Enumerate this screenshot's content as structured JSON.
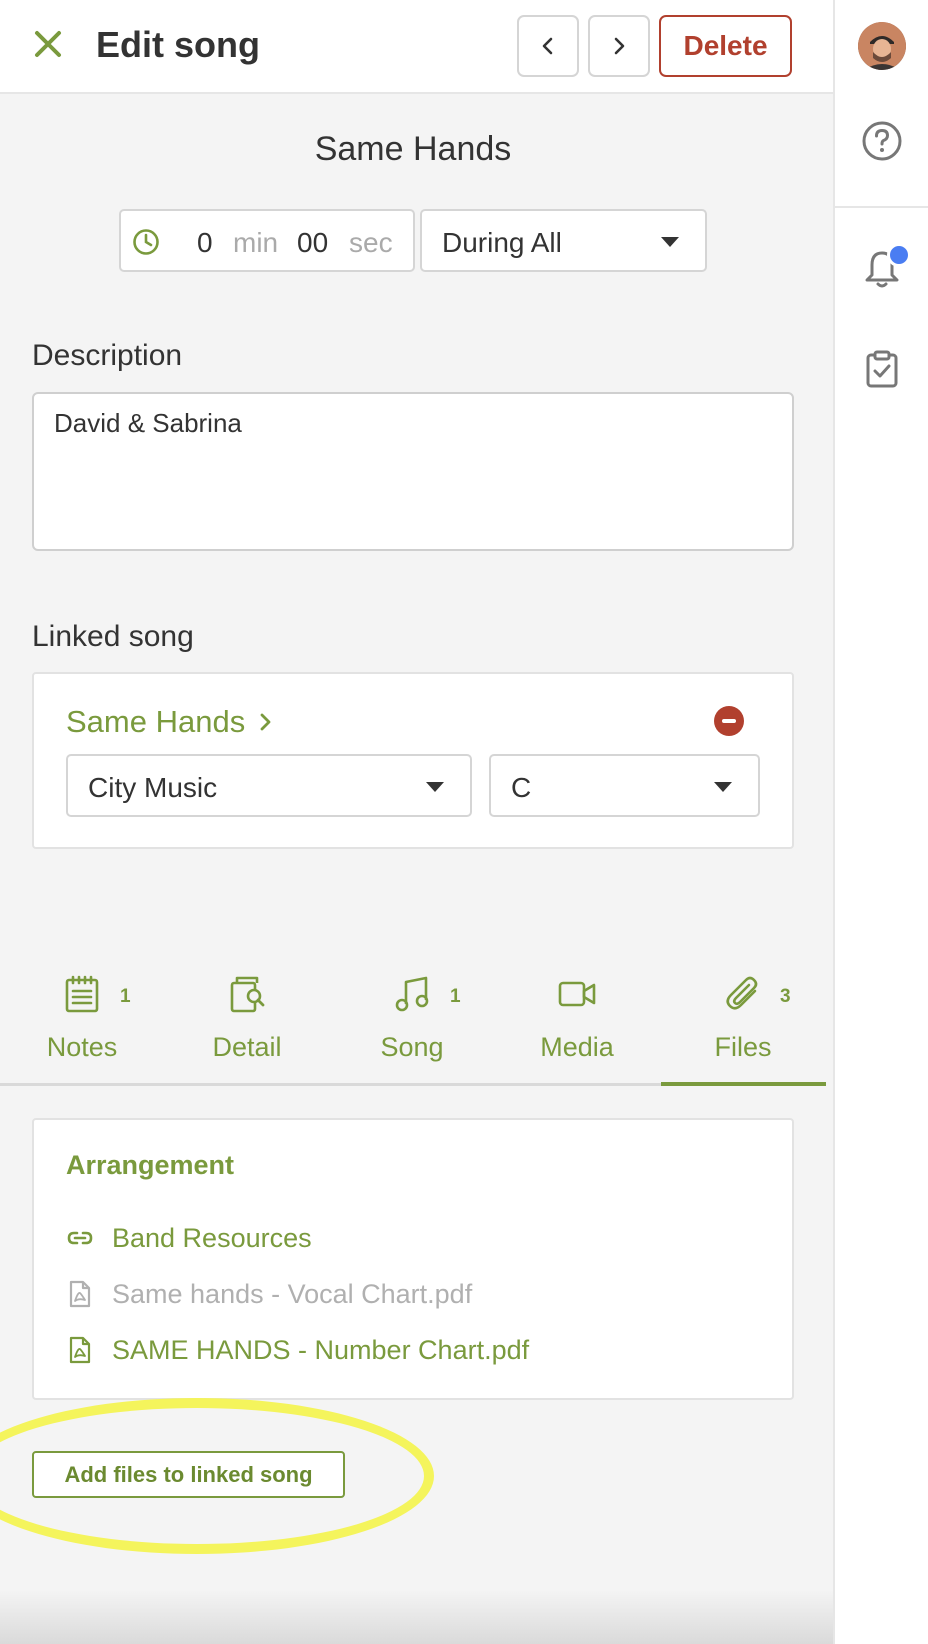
{
  "header": {
    "title": "Edit song",
    "delete_label": "Delete"
  },
  "colors": {
    "accent_green": "#7a9a3d",
    "danger_red": "#b1402e",
    "notification_blue": "#4a7df2",
    "highlight_yellow": "#f4f45c"
  },
  "song": {
    "title": "Same Hands",
    "duration": {
      "minutes": "0",
      "minutes_unit": "min",
      "seconds": "00",
      "seconds_unit": "sec"
    },
    "timing_selected": "During All"
  },
  "description": {
    "label": "Description",
    "value": "David & Sabrina"
  },
  "linked_song": {
    "label": "Linked song",
    "title": "Same Hands",
    "arrangement_selected": "City Music",
    "key_selected": "C"
  },
  "tabs": [
    {
      "label": "Notes",
      "count": "1",
      "icon": "notes-icon"
    },
    {
      "label": "Detail",
      "count": "",
      "icon": "detail-icon"
    },
    {
      "label": "Song",
      "count": "1",
      "icon": "music-note-icon"
    },
    {
      "label": "Media",
      "count": "",
      "icon": "video-camera-icon"
    },
    {
      "label": "Files",
      "count": "3",
      "icon": "paperclip-icon",
      "active": true
    }
  ],
  "files": {
    "heading": "Arrangement",
    "items": [
      {
        "label": "Band Resources",
        "icon": "link-icon",
        "enabled": true
      },
      {
        "label": "Same hands - Vocal Chart.pdf",
        "icon": "pdf-icon",
        "enabled": false
      },
      {
        "label": "SAME HANDS - Number Chart.pdf",
        "icon": "pdf-icon",
        "enabled": true
      }
    ],
    "add_button_label": "Add files to linked song"
  }
}
